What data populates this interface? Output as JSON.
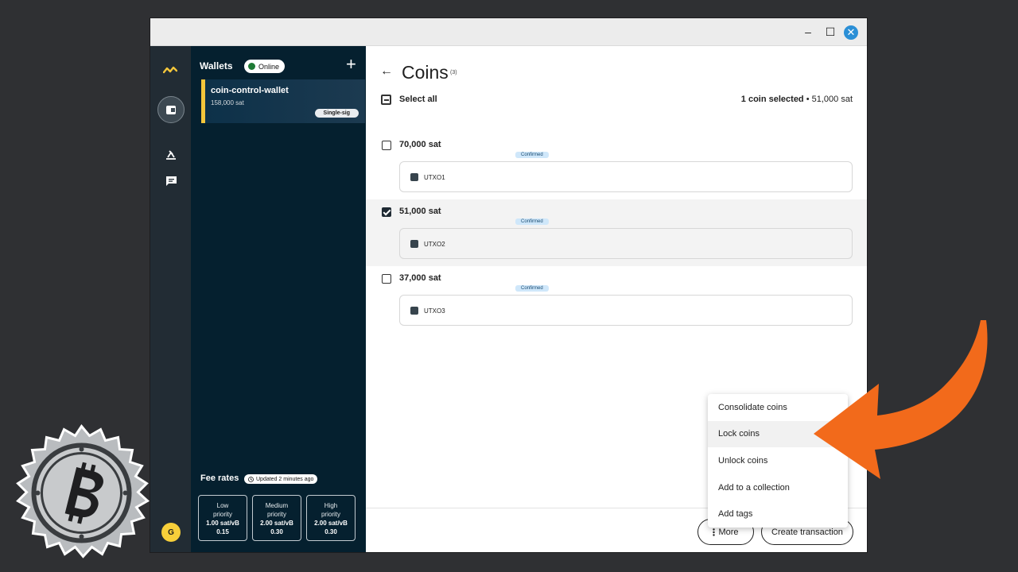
{
  "window": {
    "minimize": "–",
    "maximize": "☐",
    "close": "✕"
  },
  "rail": {
    "avatar_initial": "G"
  },
  "sidebar": {
    "title": "Wallets",
    "status": "Online",
    "add": "+",
    "wallet": {
      "name": "coin-control-wallet",
      "balance": "158,000 sat",
      "type": "Single-sig"
    },
    "fees": {
      "title": "Fee rates",
      "updated": "Updated 2 minutes ago",
      "cards": [
        {
          "line1": "Low",
          "line2": "priority",
          "rate": "1.00 sat/vB",
          "usd": "0.15"
        },
        {
          "line1": "Medium",
          "line2": "priority",
          "rate": "2.00 sat/vB",
          "usd": "0.30"
        },
        {
          "line1": "High",
          "line2": "priority",
          "rate": "2.00 sat/vB",
          "usd": "0.30"
        }
      ]
    }
  },
  "main": {
    "back": "←",
    "title": "Coins",
    "count": "(3)",
    "select_all": "Select all",
    "selection_count": "1 coin selected",
    "selection_sep": " • ",
    "selection_amount": "51,000 sat",
    "coins": [
      {
        "amount": "70,000 sat",
        "status": "Confirmed",
        "utxo": "UTXO1",
        "selected": false
      },
      {
        "amount": "51,000 sat",
        "status": "Confirmed",
        "utxo": "UTXO2",
        "selected": true
      },
      {
        "amount": "37,000 sat",
        "status": "Confirmed",
        "utxo": "UTXO3",
        "selected": false
      }
    ],
    "more_label": "More",
    "create_label": "Create transaction"
  },
  "menu": {
    "items": [
      "Consolidate coins",
      "Lock coins",
      "Unlock coins",
      "Add to a collection",
      "Add tags"
    ]
  },
  "colors": {
    "sidebar": "#05202f",
    "rail": "#222c34",
    "accent": "#f3c63b",
    "arrow": "#f26a1b",
    "confirmed_bg": "#cfe7fa"
  }
}
